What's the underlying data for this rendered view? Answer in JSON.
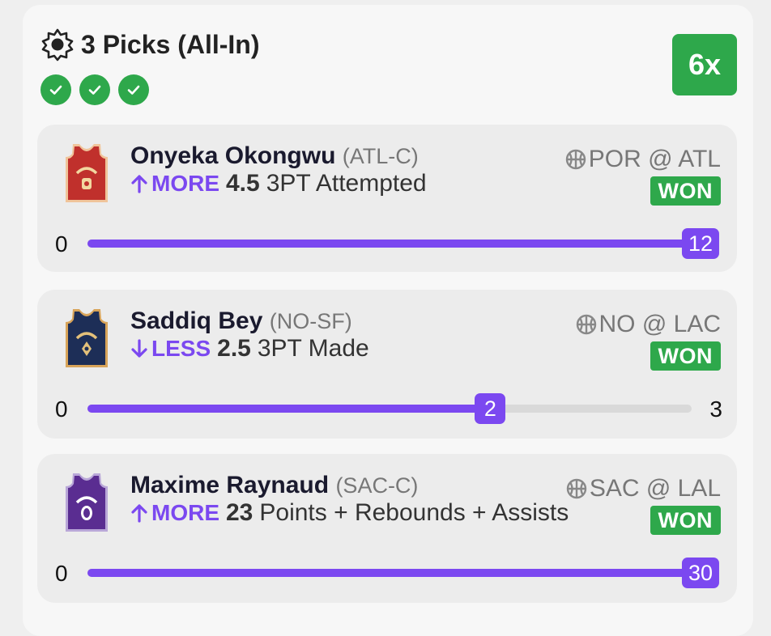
{
  "header": {
    "title": "3 Picks (All-In)",
    "multiplier": "6x",
    "check_count": 3
  },
  "colors": {
    "accent": "#7b48f0",
    "won": "#2ea84b"
  },
  "picks": [
    {
      "player": "Onyeka Okongwu",
      "team_pos": "(ATL-C)",
      "direction": "MORE",
      "line": "4.5",
      "stat": "3PT Attempted",
      "matchup": "POR @ ATL",
      "result": "WON",
      "min": "0",
      "max": "",
      "actual": "12",
      "progress": 1.0,
      "jersey": "atl-jersey-icon"
    },
    {
      "player": "Saddiq Bey",
      "team_pos": "(NO-SF)",
      "direction": "LESS",
      "line": "2.5",
      "stat": "3PT Made",
      "matchup": "NO @ LAC",
      "result": "WON",
      "min": "0",
      "max": "3",
      "actual": "2",
      "progress": 0.6667,
      "jersey": "no-jersey-icon"
    },
    {
      "player": "Maxime Raynaud",
      "team_pos": "(SAC-C)",
      "direction": "MORE",
      "line": "23",
      "stat": "Points + Rebounds + Assists",
      "matchup": "SAC @ LAL",
      "result": "WON",
      "min": "0",
      "max": "",
      "actual": "30",
      "progress": 1.0,
      "jersey": "sac-jersey-icon"
    }
  ]
}
